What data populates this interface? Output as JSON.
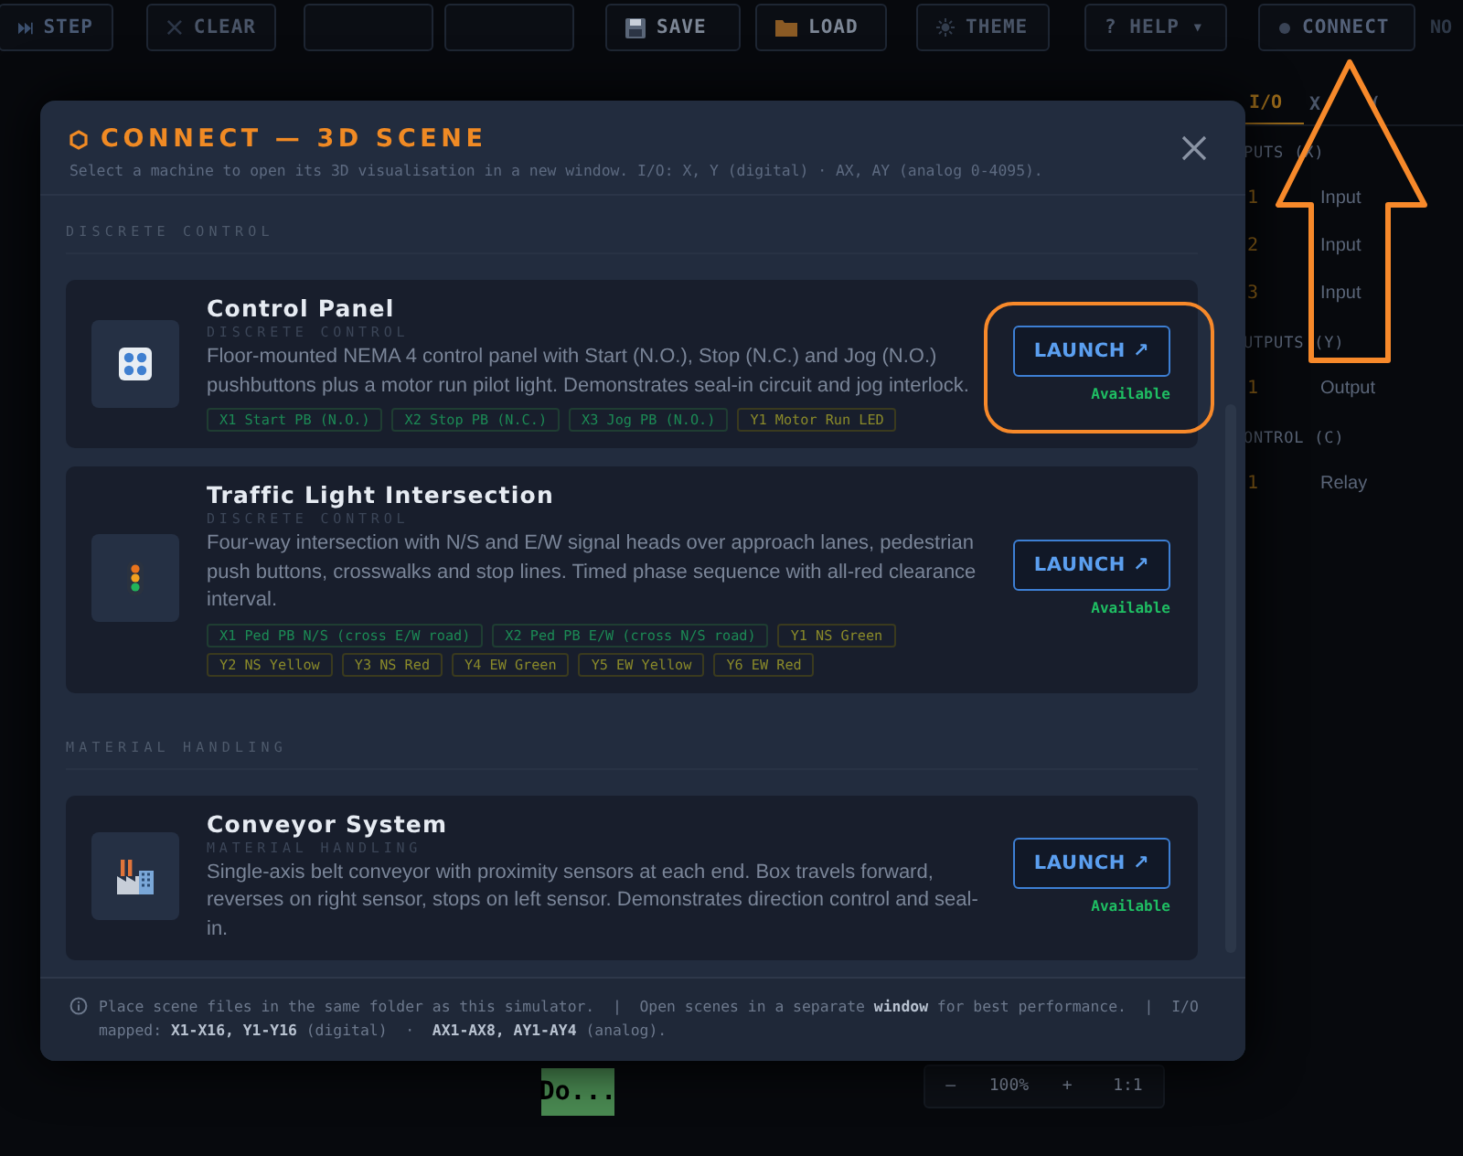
{
  "toolbar": {
    "buttons": [
      {
        "kind": "step",
        "label": "STEP"
      },
      {
        "kind": "clear",
        "label": "CLEAR"
      },
      {
        "kind": "blank"
      },
      {
        "kind": "blank"
      },
      {
        "kind": "save",
        "label": "SAVE"
      },
      {
        "kind": "load",
        "label": "LOAD"
      },
      {
        "kind": "theme",
        "label": "THEME"
      },
      {
        "kind": "help",
        "label": "? HELP ▾"
      },
      {
        "kind": "connect",
        "label": "CONNECT"
      }
    ],
    "cut_label": "NO"
  },
  "side_panel": {
    "tabs": [
      {
        "label": "I/O",
        "selected": true
      },
      {
        "label": "X",
        "selected": false
      },
      {
        "label": "(",
        "selected": false
      }
    ],
    "sections": [
      {
        "heading": "PUTS (X)",
        "rows": [
          {
            "index": "1",
            "label": "Input"
          },
          {
            "index": "2",
            "label": "Input"
          },
          {
            "index": "3",
            "label": "Input"
          }
        ]
      },
      {
        "heading": "UTPUTS (Y)",
        "rows": [
          {
            "index": "1",
            "label": "Output"
          }
        ]
      },
      {
        "heading": "ONTROL (C)",
        "rows": [
          {
            "index": "1",
            "label": "Relay"
          }
        ]
      }
    ]
  },
  "canvas": {
    "block_label": "Do...",
    "zoom": {
      "minus": "–",
      "value": "100%",
      "plus": "+",
      "reset": "1:1"
    }
  },
  "modal": {
    "title": "CONNECT — 3D SCENE",
    "subtitle": "Select a machine to open its 3D visualisation in a new window. I/O: X, Y (digital) · AX, AY (analog 0-4095).",
    "groups": [
      {
        "heading": "DISCRETE CONTROL",
        "scenes": [
          {
            "kind": "control-panel",
            "name": "Control Panel",
            "category": "DISCRETE CONTROL",
            "description": "Floor-mounted NEMA 4 control panel with Start (N.O.), Stop (N.C.) and Jog (N.O.) pushbuttons plus a motor run pilot light. Demonstrates seal-in circuit and jog interlock.",
            "tags": [
              {
                "kind": "input",
                "label": "X1 Start PB (N.O.)"
              },
              {
                "kind": "input",
                "label": "X2 Stop PB (N.C.)"
              },
              {
                "kind": "input",
                "label": "X3 Jog PB (N.O.)"
              },
              {
                "kind": "output",
                "label": "Y1 Motor Run LED"
              }
            ],
            "button": "LAUNCH ↗",
            "status": "Available",
            "highlighted": true
          },
          {
            "kind": "traffic-light",
            "name": "Traffic Light Intersection",
            "category": "DISCRETE CONTROL",
            "description": "Four-way intersection with N/S and E/W signal heads over approach lanes, pedestrian push buttons, crosswalks and stop lines. Timed phase sequence with all-red clearance interval.",
            "tags": [
              {
                "kind": "input",
                "label": "X1 Ped PB N/S (cross E/W road)"
              },
              {
                "kind": "input",
                "label": "X2 Ped PB E/W (cross N/S road)"
              },
              {
                "kind": "output",
                "label": "Y1 NS Green"
              },
              {
                "kind": "output",
                "label": "Y2 NS Yellow"
              },
              {
                "kind": "output",
                "label": "Y3 NS Red"
              },
              {
                "kind": "output",
                "label": "Y4 EW Green"
              },
              {
                "kind": "output",
                "label": "Y5 EW Yellow"
              },
              {
                "kind": "output",
                "label": "Y6 EW Red"
              }
            ],
            "button": "LAUNCH ↗",
            "status": "Available",
            "highlighted": false
          }
        ]
      },
      {
        "heading": "MATERIAL HANDLING",
        "scenes": [
          {
            "kind": "factory",
            "name": "Conveyor System",
            "category": "MATERIAL HANDLING",
            "description": "Single-axis belt conveyor with proximity sensors at each end. Box travels forward, reverses on right sensor, stops on left sensor. Demonstrates direction control and seal-in.",
            "button": "LAUNCH ↗",
            "status": "Available",
            "highlighted": false
          }
        ]
      }
    ],
    "footer": "Place scene files in the same folder as this simulator.  |  Open scenes in a separate **window** for best performance.  |  I/O mapped: **X1-X16, Y1-Y16** (digital)  ·  **AX1-AX8, AY1-AY4** (analog)."
  },
  "annotation": {
    "arrow_to_connect": true
  }
}
